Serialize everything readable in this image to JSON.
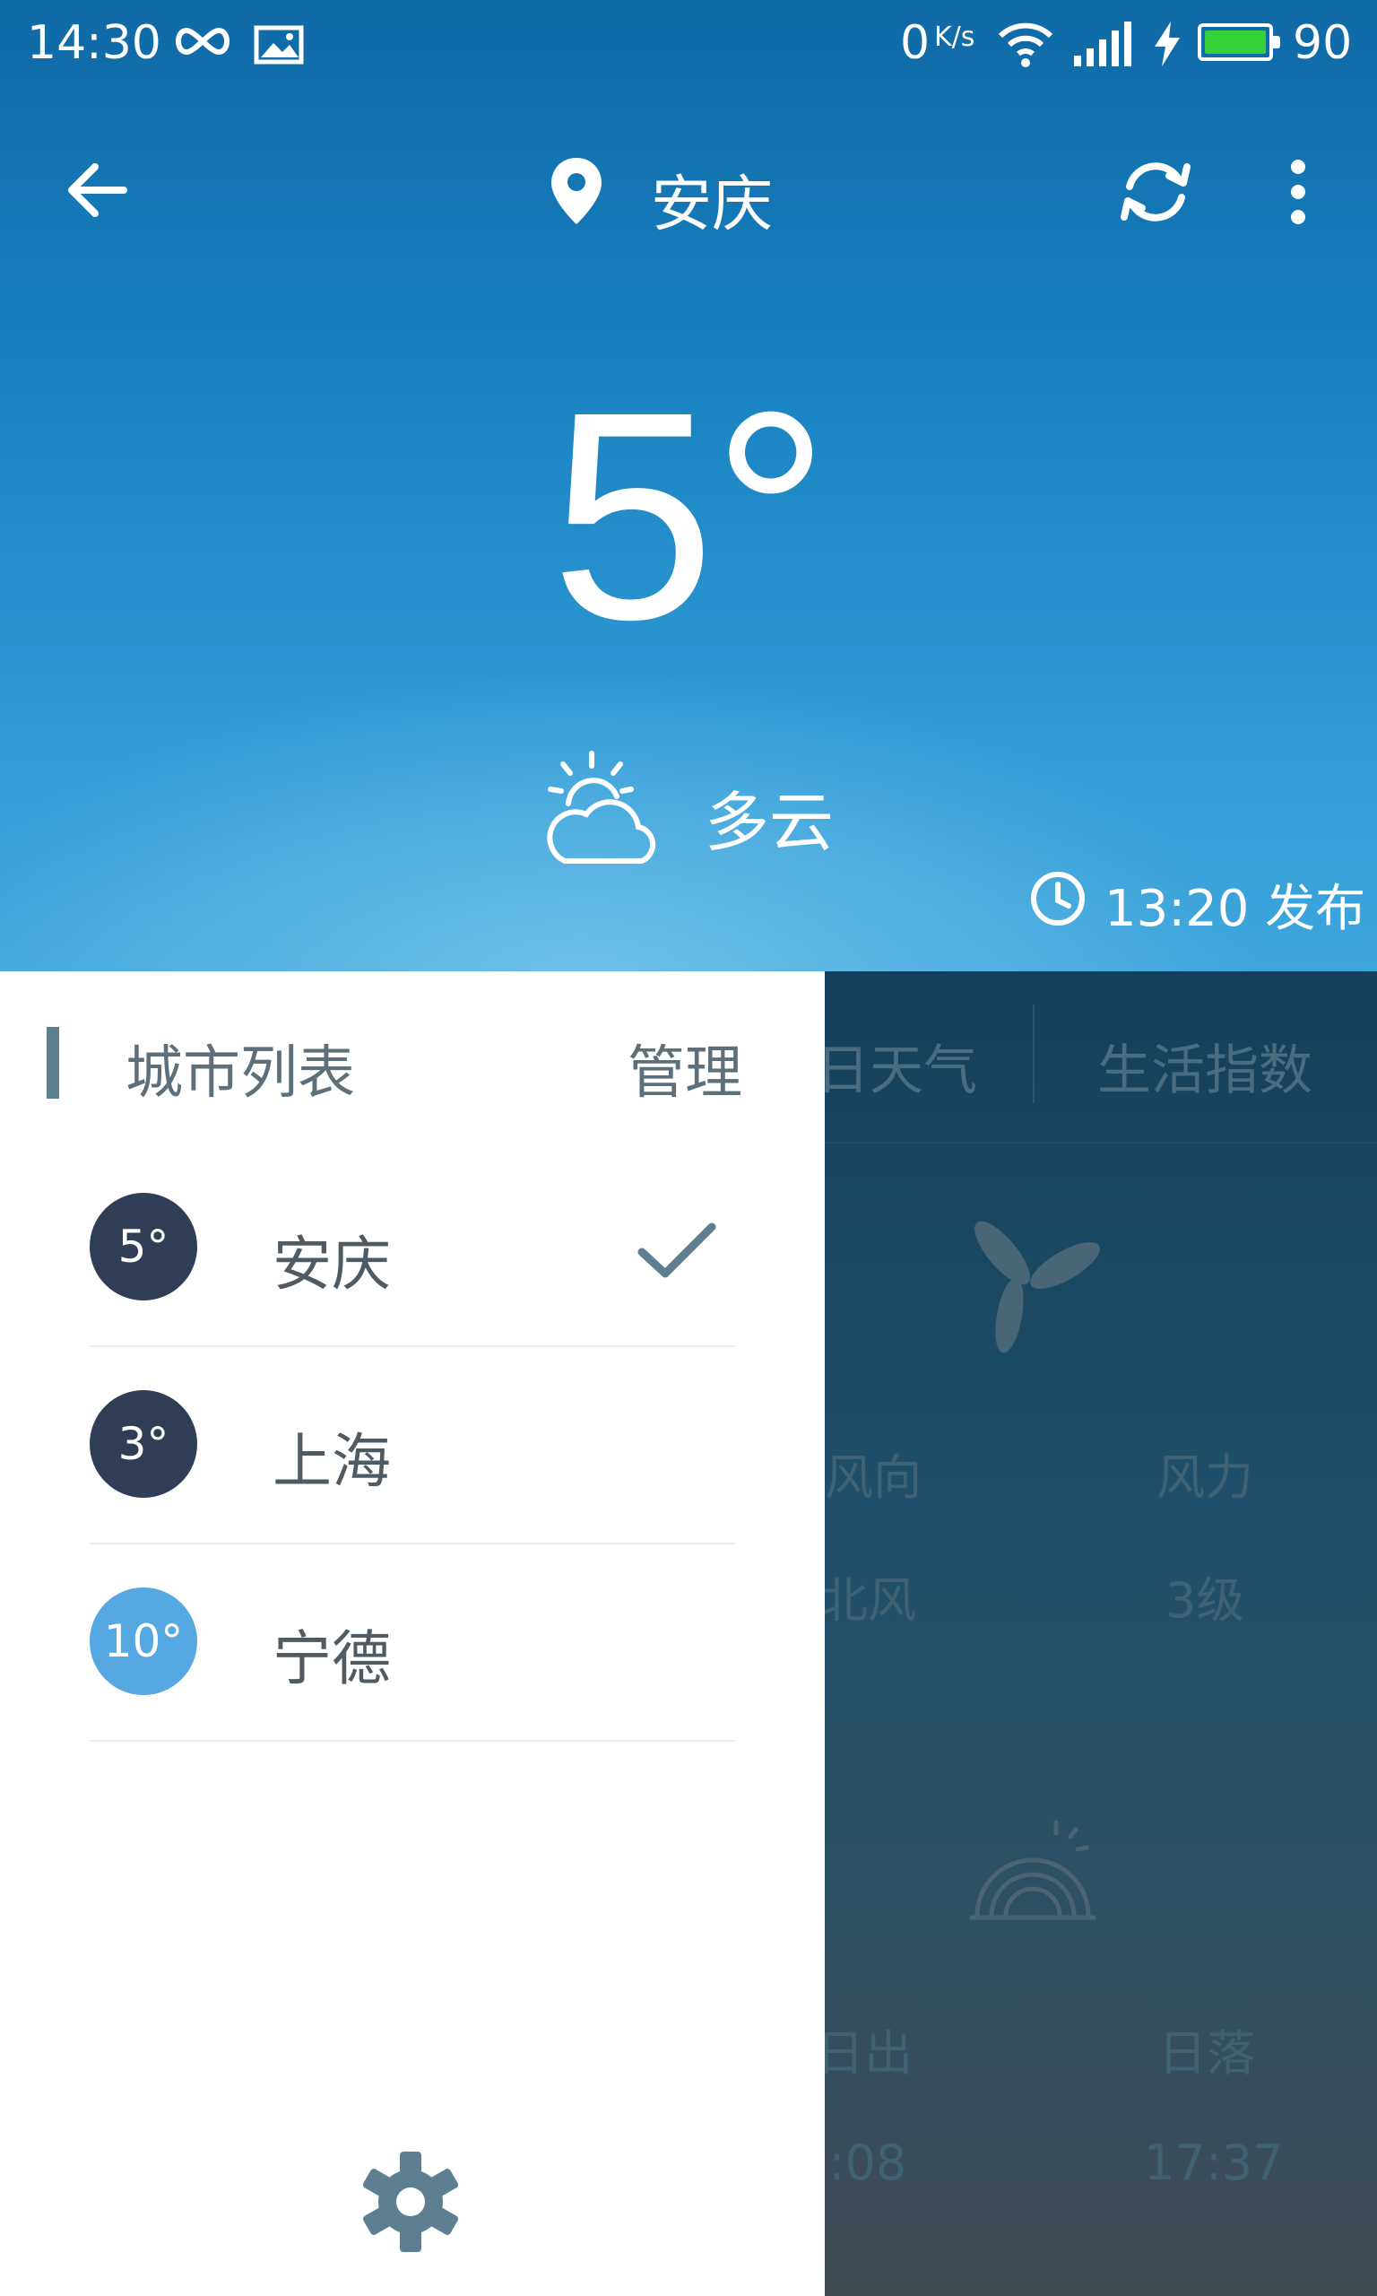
{
  "status_bar": {
    "time": "14:30",
    "net_speed": "0",
    "net_speed_unit": "K/s",
    "battery": "90"
  },
  "header": {
    "city": "安庆"
  },
  "current": {
    "temperature": "5°",
    "condition": "多云",
    "published": "13:20 发布"
  },
  "background_panel": {
    "tabs": [
      "日天气",
      "生活指数"
    ],
    "wind_direction_label": "风向",
    "wind_direction_value": "东北风",
    "wind_force_label": "风力",
    "wind_force_value": "3级",
    "sunrise_label": "日出",
    "sunrise_value": "7:08",
    "sunset_label": "日落",
    "sunset_value": "17:37"
  },
  "drawer": {
    "title": "城市列表",
    "manage": "管理",
    "cities": [
      {
        "temp": "5°",
        "name": "安庆",
        "selected": true,
        "badge_color": "#2f3d57"
      },
      {
        "temp": "3°",
        "name": "上海",
        "selected": false,
        "badge_color": "#2f3d57"
      },
      {
        "temp": "10°",
        "name": "宁德",
        "selected": false,
        "badge_color": "#55a8e2"
      }
    ]
  },
  "colors": {
    "hero_top": "#0f69a5",
    "hero_bottom": "#3ea6dc",
    "accent_gray": "#5e7f92",
    "text_gray": "#5d6f7b"
  },
  "icons": {
    "back": "arrow-left-icon",
    "location": "map-pin-icon",
    "refresh": "refresh-icon",
    "more": "more-vertical-icon",
    "weather": "partly-cloudy-icon",
    "clock": "clock-icon",
    "check": "check-icon",
    "settings": "gear-icon"
  }
}
